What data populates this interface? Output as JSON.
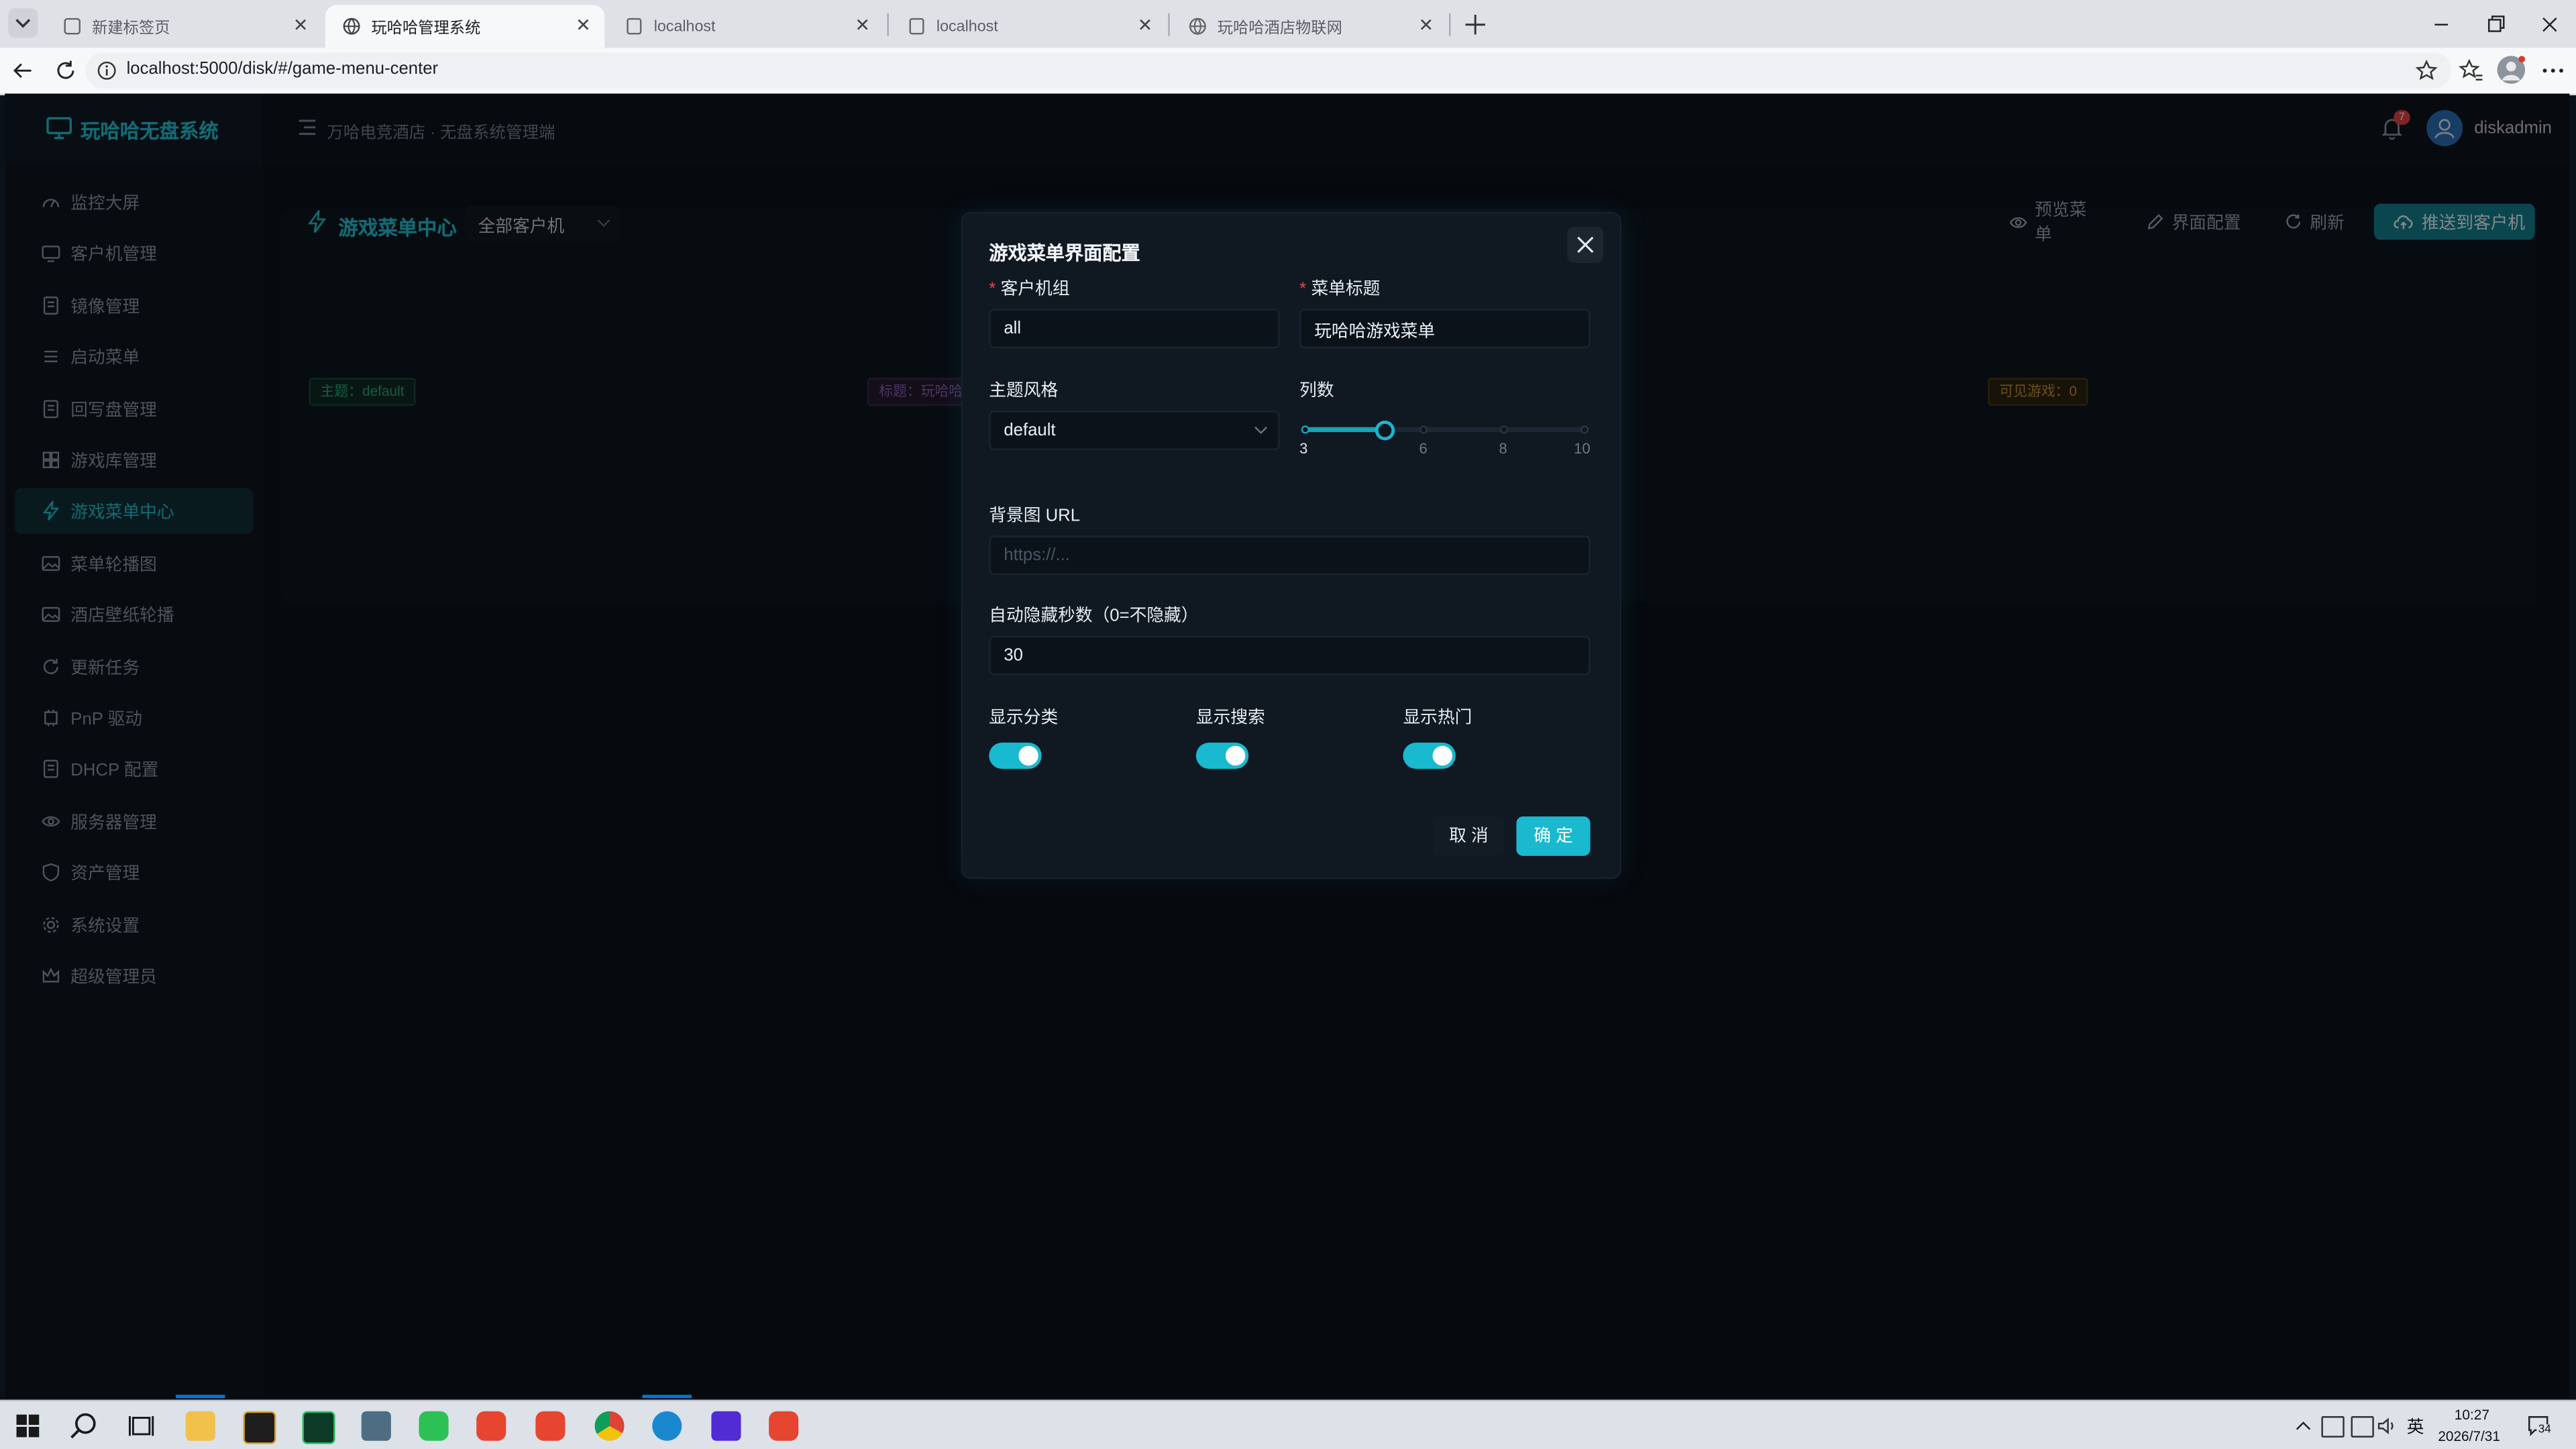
{
  "browser": {
    "tabs": [
      {
        "label": "新建标签页",
        "active": false
      },
      {
        "label": "玩哈哈管理系统",
        "active": true
      },
      {
        "label": "localhost",
        "active": false
      },
      {
        "label": "localhost",
        "active": false
      },
      {
        "label": "玩哈哈酒店物联网",
        "active": false
      }
    ],
    "url": "localhost:5000/disk/#/game-menu-center"
  },
  "app": {
    "logo_text": "玩哈哈无盘系统",
    "header_subtitle": "万哈电竞酒店 · 无盘系统管理端",
    "notification_count": "7",
    "username": "diskadmin"
  },
  "sidebar": {
    "items": [
      {
        "label": "监控大屏",
        "icon": "dashboard-icon",
        "active": false
      },
      {
        "label": "客户机管理",
        "icon": "monitor-icon",
        "active": false
      },
      {
        "label": "镜像管理",
        "icon": "disk-icon",
        "active": false
      },
      {
        "label": "启动菜单",
        "icon": "list-icon",
        "active": false
      },
      {
        "label": "回写盘管理",
        "icon": "disk-icon",
        "active": false
      },
      {
        "label": "游戏库管理",
        "icon": "grid-icon",
        "active": false
      },
      {
        "label": "游戏菜单中心",
        "icon": "lightning-icon",
        "active": true
      },
      {
        "label": "菜单轮播图",
        "icon": "image-icon",
        "active": false
      },
      {
        "label": "酒店壁纸轮播",
        "icon": "image-icon",
        "active": false
      },
      {
        "label": "更新任务",
        "icon": "refresh-icon",
        "active": false
      },
      {
        "label": "PnP 驱动",
        "icon": "chip-icon",
        "active": false
      },
      {
        "label": "DHCP 配置",
        "icon": "disk-icon",
        "active": false
      },
      {
        "label": "服务器管理",
        "icon": "server-icon",
        "active": false
      },
      {
        "label": "资产管理",
        "icon": "shield-icon",
        "active": false
      },
      {
        "label": "系统设置",
        "icon": "gear-icon",
        "active": false
      },
      {
        "label": "超级管理员",
        "icon": "crown-icon",
        "active": false
      }
    ]
  },
  "page": {
    "title": "游戏菜单中心",
    "client_filter": "全部客户机",
    "buttons": {
      "preview": "预览菜单",
      "ui_config": "界面配置",
      "refresh": "刷新",
      "push": "推送到客户机"
    },
    "tags": {
      "theme": "主题：default",
      "title": "标题：玩哈哈",
      "visible_games": "可见游戏：0"
    }
  },
  "modal": {
    "title": "游戏菜单界面配置",
    "client_group_label": "客户机组",
    "client_group_value": "all",
    "menu_title_label": "菜单标题",
    "menu_title_value": "玩哈哈游戏菜单",
    "theme_label": "主题风格",
    "theme_value": "default",
    "columns_label": "列数",
    "columns_value": 5,
    "columns_min": 3,
    "columns_max": 10,
    "columns_marks": [
      "3",
      "6",
      "8",
      "10"
    ],
    "bg_url_label": "背景图 URL",
    "bg_url_placeholder": "https://...",
    "auto_hide_label": "自动隐藏秒数（0=不隐藏）",
    "auto_hide_value": "30",
    "show_category_label": "显示分类",
    "show_search_label": "显示搜索",
    "show_hot_label": "显示热门",
    "show_category": true,
    "show_search": true,
    "show_hot": true,
    "cancel_label": "取 消",
    "ok_label": "确 定"
  },
  "taskbar": {
    "time": "10:27",
    "date": "2026/7/31",
    "ime": "英",
    "notification_badge": "34"
  },
  "colors": {
    "accent": "#19b9cf",
    "background": "#0b1119",
    "modal_bg": "#101822"
  }
}
